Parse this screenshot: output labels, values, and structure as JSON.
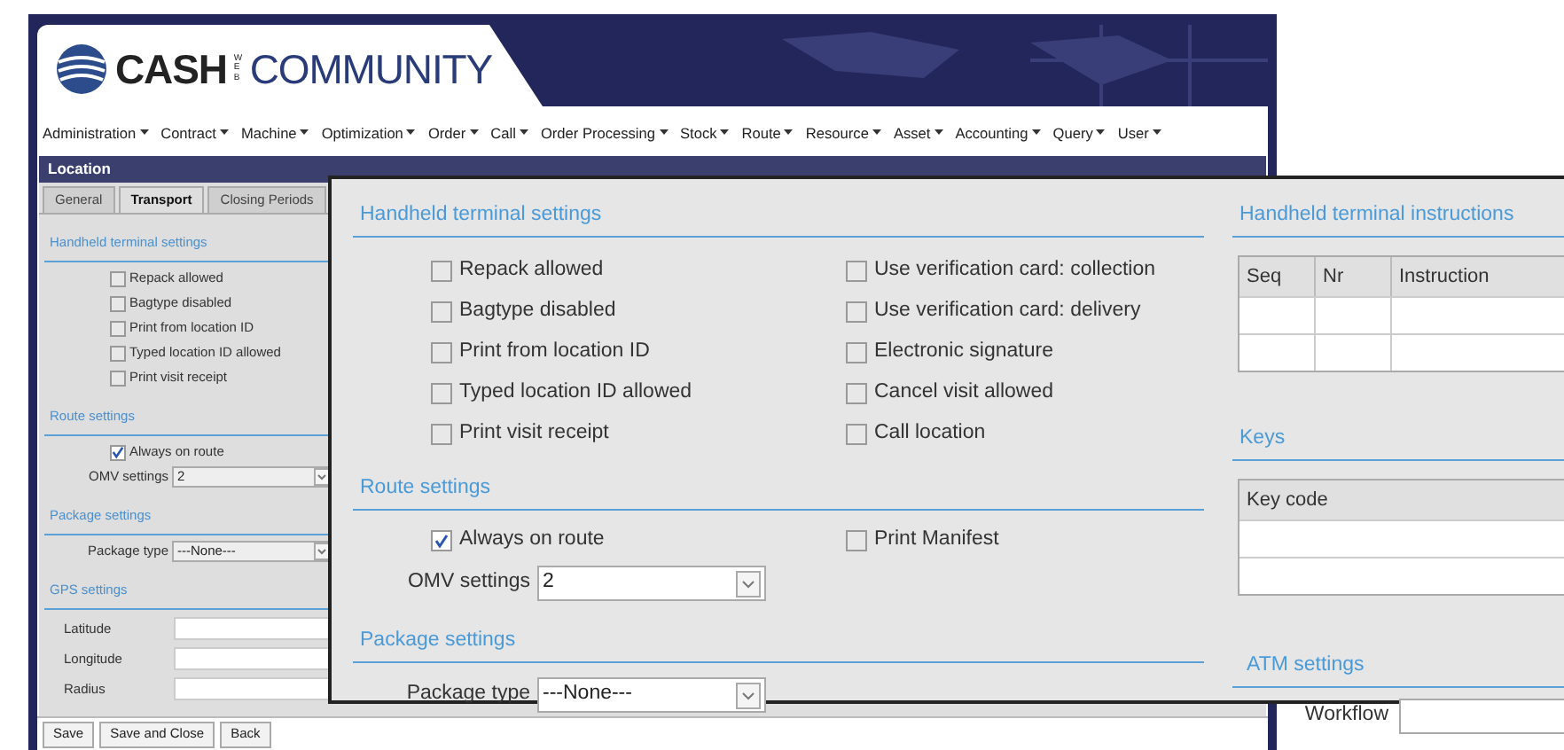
{
  "app": {
    "logo": {
      "primary": "CASH",
      "small": "WEB",
      "secondary": "COMMUNITY"
    },
    "menu": [
      "Administration",
      "Contract",
      "Machine",
      "Optimization",
      "Order",
      "Call",
      "Order Processing",
      "Stock",
      "Route",
      "Resource",
      "Asset",
      "Accounting",
      "Query",
      "User"
    ]
  },
  "location_panel": {
    "title": "Location",
    "tabs": [
      {
        "label": "General",
        "selected": false
      },
      {
        "label": "Transport",
        "selected": true
      },
      {
        "label": "Closing Periods",
        "selected": false
      }
    ],
    "sections": [
      {
        "title": "Handheld terminal settings",
        "items": [
          {
            "kind": "checkbox",
            "label": "Repack allowed",
            "checked": false
          },
          {
            "kind": "checkbox",
            "label": "Bagtype disabled",
            "checked": false
          },
          {
            "kind": "checkbox",
            "label": "Print from location ID",
            "checked": false
          },
          {
            "kind": "checkbox",
            "label": "Typed location ID allowed",
            "checked": false
          },
          {
            "kind": "checkbox",
            "label": "Print visit receipt",
            "checked": false
          }
        ]
      },
      {
        "title": "Route settings",
        "items": [
          {
            "kind": "checkbox",
            "label": "Always on route",
            "checked": true
          },
          {
            "kind": "select",
            "label": "OMV settings",
            "value": "2"
          }
        ]
      },
      {
        "title": "Package settings",
        "items": [
          {
            "kind": "select",
            "label": "Package type",
            "value": "---None---"
          }
        ]
      },
      {
        "title": "GPS settings",
        "items": [
          {
            "kind": "text",
            "label": "Latitude"
          },
          {
            "kind": "text",
            "label": "Longitude"
          },
          {
            "kind": "text",
            "label": "Radius"
          }
        ]
      }
    ],
    "buttons": [
      "Save",
      "Save and Close",
      "Back"
    ]
  },
  "zoom_panel": {
    "sections": [
      {
        "title": "Handheld terminal settings",
        "items": [
          {
            "kind": "checkbox",
            "label": "Repack allowed",
            "checked": false
          },
          {
            "kind": "checkbox",
            "label": "Use verification card: collection",
            "checked": false
          },
          {
            "kind": "checkbox",
            "label": "Bagtype disabled",
            "checked": false
          },
          {
            "kind": "checkbox",
            "label": "Use verification card: delivery",
            "checked": false
          },
          {
            "kind": "checkbox",
            "label": "Print from location ID",
            "checked": false
          },
          {
            "kind": "checkbox",
            "label": "Electronic signature",
            "checked": false
          },
          {
            "kind": "checkbox",
            "label": "Typed location ID allowed",
            "checked": false
          },
          {
            "kind": "checkbox",
            "label": "Cancel visit allowed",
            "checked": false
          },
          {
            "kind": "checkbox",
            "label": "Print visit receipt",
            "checked": false
          },
          {
            "kind": "checkbox",
            "label": "Call location",
            "checked": false
          }
        ]
      },
      {
        "title": "Route settings",
        "items": [
          {
            "kind": "checkbox",
            "label": "Always on route",
            "checked": true
          },
          {
            "kind": "checkbox",
            "label": "Print Manifest",
            "checked": false
          },
          {
            "kind": "select",
            "label": "OMV settings",
            "value": "2"
          }
        ]
      },
      {
        "title": "Package settings",
        "items": [
          {
            "kind": "select",
            "label": "Package type",
            "value": "---None---"
          }
        ]
      }
    ],
    "instructions": {
      "title": "Handheld terminal instructions",
      "columns": [
        "Seq",
        "Nr",
        "Instruction"
      ]
    },
    "keys": {
      "title": "Keys",
      "columns": [
        "Key code"
      ]
    },
    "atm": {
      "title": "ATM settings",
      "fields": [
        {
          "label": "Workflow"
        }
      ]
    }
  }
}
